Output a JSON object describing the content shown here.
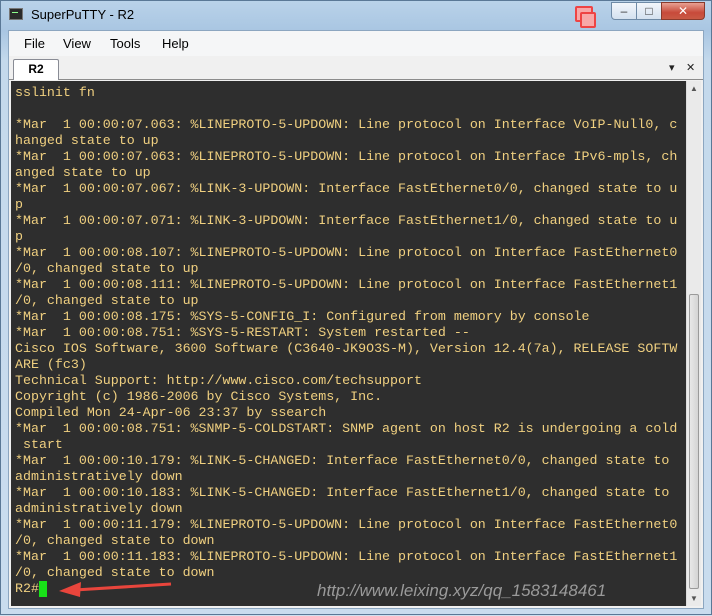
{
  "window": {
    "title": "SuperPuTTY - R2"
  },
  "caption": {
    "minimize": "–",
    "maximize": "□",
    "close": "✕"
  },
  "menu": [
    "File",
    "View",
    "Tools",
    "Help"
  ],
  "tabs": [
    {
      "label": "R2",
      "active": true
    }
  ],
  "tabstrip": {
    "dropdown": "▾",
    "close": "✕"
  },
  "terminal": {
    "lines": [
      "sslinit fn",
      "",
      "*Mar  1 00:00:07.063: %LINEPROTO-5-UPDOWN: Line protocol on Interface VoIP-Null0, c",
      "hanged state to up",
      "*Mar  1 00:00:07.063: %LINEPROTO-5-UPDOWN: Line protocol on Interface IPv6-mpls, ch",
      "anged state to up",
      "*Mar  1 00:00:07.067: %LINK-3-UPDOWN: Interface FastEthernet0/0, changed state to u",
      "p",
      "*Mar  1 00:00:07.071: %LINK-3-UPDOWN: Interface FastEthernet1/0, changed state to u",
      "p",
      "*Mar  1 00:00:08.107: %LINEPROTO-5-UPDOWN: Line protocol on Interface FastEthernet0",
      "/0, changed state to up",
      "*Mar  1 00:00:08.111: %LINEPROTO-5-UPDOWN: Line protocol on Interface FastEthernet1",
      "/0, changed state to up",
      "*Mar  1 00:00:08.175: %SYS-5-CONFIG_I: Configured from memory by console",
      "*Mar  1 00:00:08.751: %SYS-5-RESTART: System restarted --",
      "Cisco IOS Software, 3600 Software (C3640-JK9O3S-M), Version 12.4(7a), RELEASE SOFTW",
      "ARE (fc3)",
      "Technical Support: http://www.cisco.com/techsupport",
      "Copyright (c) 1986-2006 by Cisco Systems, Inc.",
      "Compiled Mon 24-Apr-06 23:37 by ssearch",
      "*Mar  1 00:00:08.751: %SNMP-5-COLDSTART: SNMP agent on host R2 is undergoing a cold",
      " start",
      "*Mar  1 00:00:10.179: %LINK-5-CHANGED: Interface FastEthernet0/0, changed state to",
      "administratively down",
      "*Mar  1 00:00:10.183: %LINK-5-CHANGED: Interface FastEthernet1/0, changed state to",
      "administratively down",
      "*Mar  1 00:00:11.179: %LINEPROTO-5-UPDOWN: Line protocol on Interface FastEthernet0",
      "/0, changed state to down",
      "*Mar  1 00:00:11.183: %LINEPROTO-5-UPDOWN: Line protocol on Interface FastEthernet1",
      "/0, changed state to down",
      "R2#"
    ]
  },
  "watermark": "http://www.leixing.xyz/qq_1583148461",
  "colors": {
    "terminal_bg": "#2e2e2e",
    "terminal_fg": "#f0d080",
    "cursor": "#18e018",
    "annotation_arrow": "#e8453c"
  },
  "icons": {
    "app": "terminal-icon",
    "annotation": "red-arrow-icon"
  }
}
